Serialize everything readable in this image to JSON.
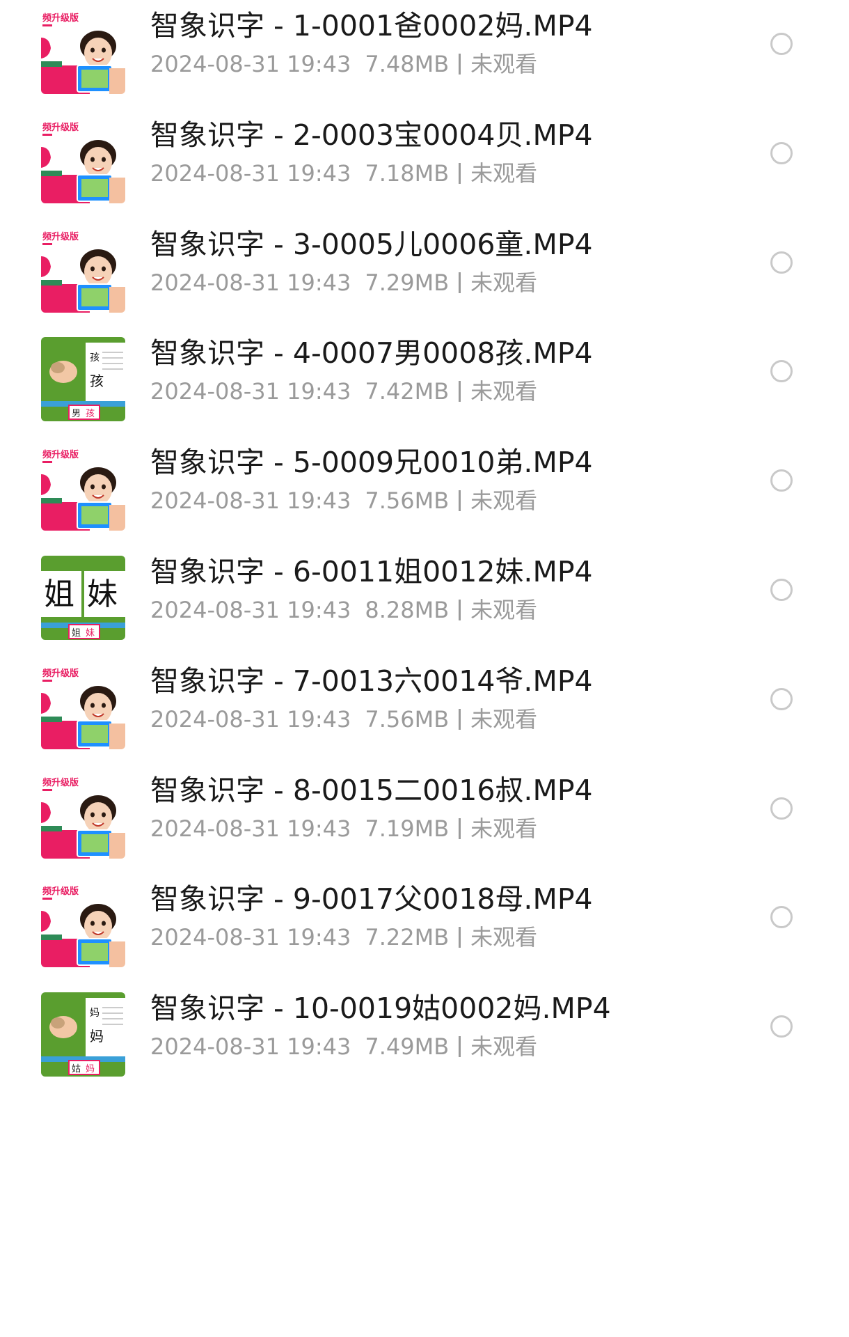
{
  "files": [
    {
      "title": "智象识字 - 1-0001爸0002妈.MP4",
      "date": "2024-08-31 19:43",
      "size": "7.48MB",
      "status": "未观看",
      "thumb": "girl",
      "thumb_label": "频升级版",
      "selected": false
    },
    {
      "title": "智象识字 - 2-0003宝0004贝.MP4",
      "date": "2024-08-31 19:43",
      "size": "7.18MB",
      "status": "未观看",
      "thumb": "girl",
      "thumb_label": "频升级版",
      "selected": false
    },
    {
      "title": "智象识字 - 3-0005儿0006童.MP4",
      "date": "2024-08-31 19:43",
      "size": "7.29MB",
      "status": "未观看",
      "thumb": "girl",
      "thumb_label": "频升级版",
      "selected": false
    },
    {
      "title": "智象识字 - 4-0007男0008孩.MP4",
      "date": "2024-08-31 19:43",
      "size": "7.42MB",
      "status": "未观看",
      "thumb": "lesson",
      "thumb_chars": [
        "男",
        "孩"
      ],
      "selected": false
    },
    {
      "title": "智象识字 - 5-0009兄0010弟.MP4",
      "date": "2024-08-31 19:43",
      "size": "7.56MB",
      "status": "未观看",
      "thumb": "girl",
      "thumb_label": "频升级版",
      "selected": false
    },
    {
      "title": "智象识字 - 6-0011姐0012妹.MP4",
      "date": "2024-08-31 19:43",
      "size": "8.28MB",
      "status": "未观看",
      "thumb": "cards",
      "thumb_chars": [
        "姐",
        "妹"
      ],
      "selected": false
    },
    {
      "title": "智象识字 - 7-0013六0014爷.MP4",
      "date": "2024-08-31 19:43",
      "size": "7.56MB",
      "status": "未观看",
      "thumb": "girl",
      "thumb_label": "频升级版",
      "selected": false
    },
    {
      "title": "智象识字 - 8-0015二0016叔.MP4",
      "date": "2024-08-31 19:43",
      "size": "7.19MB",
      "status": "未观看",
      "thumb": "girl",
      "thumb_label": "频升级版",
      "selected": false
    },
    {
      "title": "智象识字 - 9-0017父0018母.MP4",
      "date": "2024-08-31 19:43",
      "size": "7.22MB",
      "status": "未观看",
      "thumb": "girl",
      "thumb_label": "频升级版",
      "selected": false
    },
    {
      "title": "智象识字 - 10-0019姑0002妈.MP4",
      "date": "2024-08-31 19:43",
      "size": "7.49MB",
      "status": "未观看",
      "thumb": "lesson",
      "thumb_chars": [
        "姑",
        "妈"
      ],
      "selected": false
    }
  ],
  "colors": {
    "title": "#1a1a1a",
    "meta": "#9a9a9a",
    "radio_border": "#c9c9c9",
    "thumb_pink": "#e91e63",
    "thumb_green": "#5a9e2f"
  }
}
